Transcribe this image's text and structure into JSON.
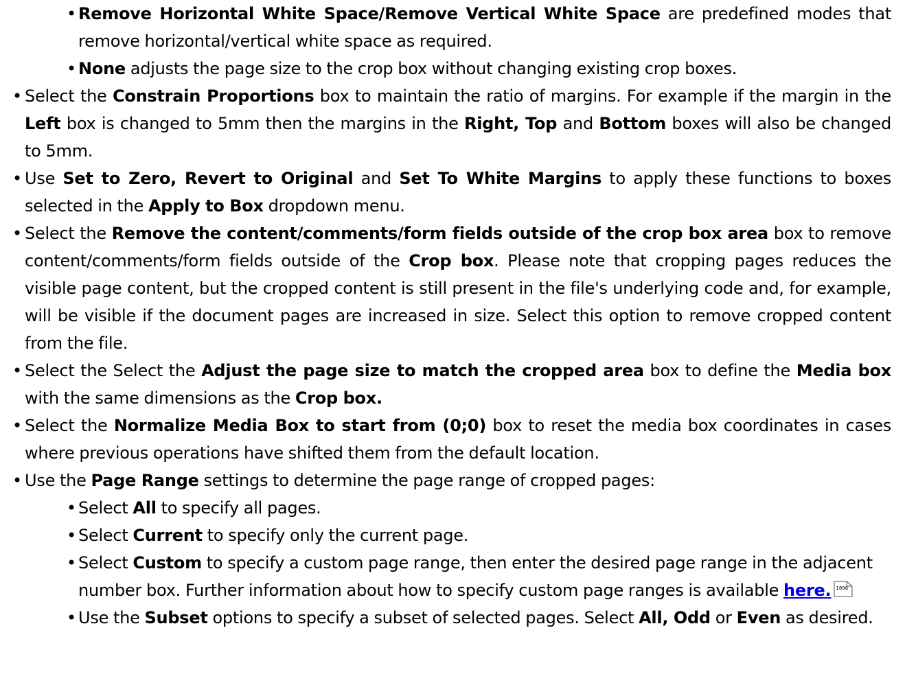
{
  "modes": {
    "remove_ws_bold": "Remove Horizontal White Space/Remove Vertical White Space",
    "remove_ws_text": " are predefined modes that remove horizontal/vertical white space as required.",
    "none_bold": "None",
    "none_text": " adjusts the page size to the crop box without changing existing crop boxes."
  },
  "constrain": {
    "t1": "Select the ",
    "b1": "Constrain Proportions",
    "t2": " box to maintain the ratio of margins. For example if the margin in the ",
    "b2": "Left",
    "t3": " box is changed to 5mm then the margins in the ",
    "b3": "Right, Top",
    "t4": " and ",
    "b4": "Bottom",
    "t5": " boxes will also be changed to 5mm."
  },
  "setzero": {
    "t1": "Use ",
    "b1": "Set to Zero, Revert to Original",
    "t2": " and ",
    "b2": "Set To White Margins",
    "t3": " to apply these functions to boxes selected in the ",
    "b3": "Apply to Box",
    "t4": " dropdown menu."
  },
  "remove_content": {
    "t1": "Select the ",
    "b1": "Remove the content/comments/form fields outside of the crop box area",
    "t2": " box to remove content/comments/form fields outside of the ",
    "b2": "Crop box",
    "t3": ". Please note that cropping pages reduces the visible page content, but the cropped content is still present in the file's underlying code and, for example, will be visible if the document pages are increased in size. Select this option to remove cropped content from the file."
  },
  "adjust": {
    "t1": "Select the Select the ",
    "b1": "Adjust the page size to match the cropped area",
    "t2": " box to define the ",
    "b2": "Media box",
    "t3": " with the same dimensions as the ",
    "b3": "Crop box."
  },
  "normalize": {
    "t1": "Select the ",
    "b1": "Normalize Media Box to start from (0;0)",
    "t2": " box to reset the media box coordinates in cases where previous operations have shifted them from the default location."
  },
  "page_range": {
    "t1": "Use the ",
    "b1": "Page Range",
    "t2": " settings to determine the page range of cropped pages:",
    "all_t1": "Select ",
    "all_b1": "All",
    "all_t2": " to specify all pages.",
    "cur_t1": "Select ",
    "cur_b1": "Current",
    "cur_t2": " to specify only the current page.",
    "cus_t1": "Select ",
    "cus_b1": "Custom",
    "cus_t2": " to specify a custom page range, then enter the desired page range in the adjacent number box. Further information about how to specify custom page ranges is available ",
    "cus_link": "here.",
    "cus_pageref": "1896",
    "sub_t1": "Use the ",
    "sub_b1": "Subset",
    "sub_t2": " options to specify a subset of selected pages. Select ",
    "sub_b2": "All, Odd",
    "sub_t3": " or ",
    "sub_b3": "Even",
    "sub_t4": " as desired."
  }
}
